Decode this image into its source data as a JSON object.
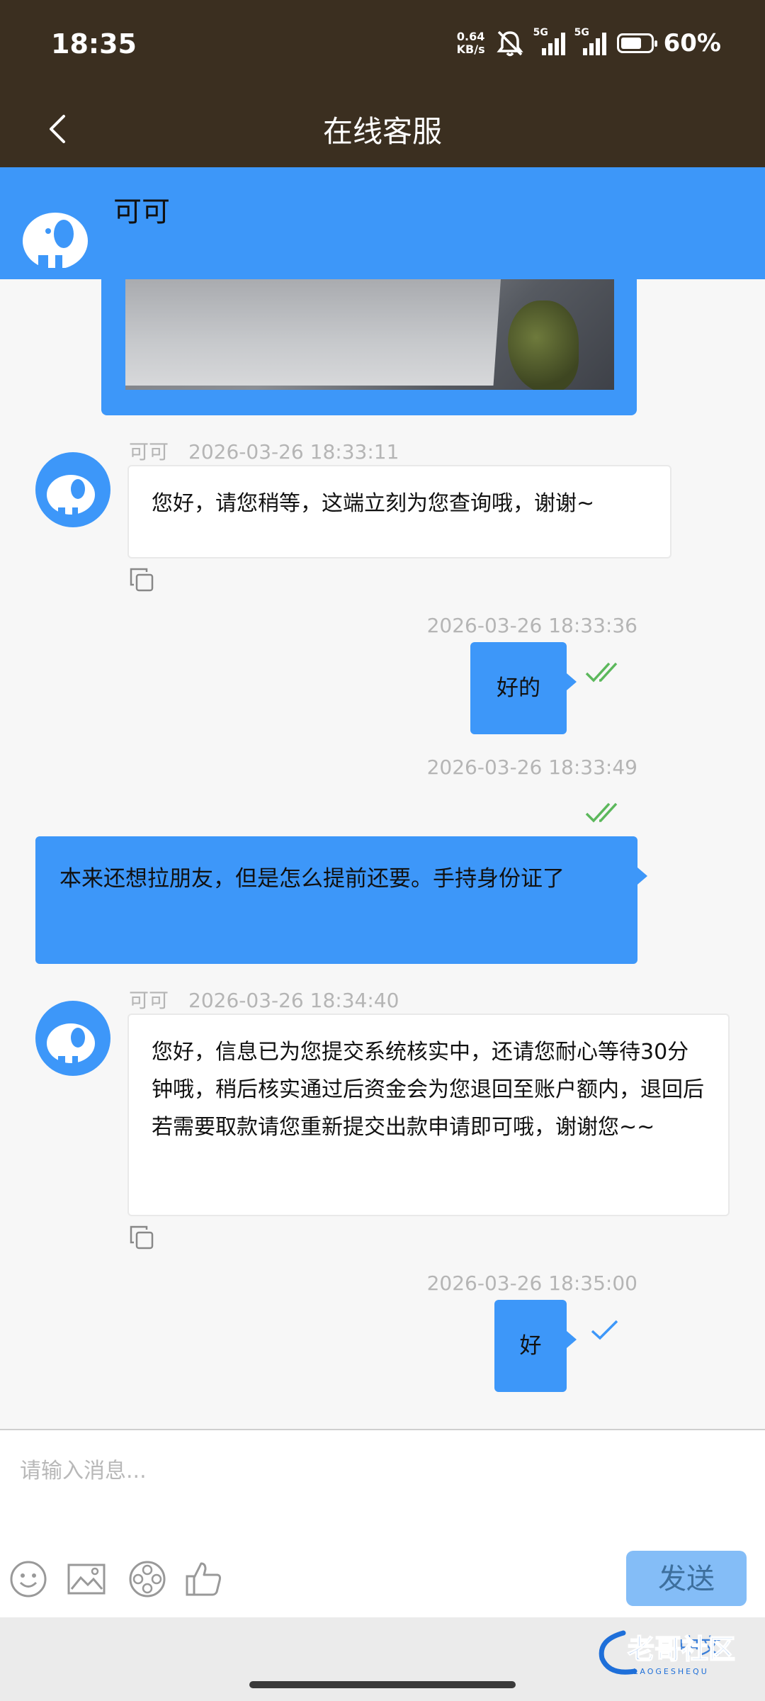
{
  "status_bar": {
    "time": "18:35",
    "net_speed_top": "0.64",
    "net_speed_bottom": "KB/s",
    "signal1": "5G",
    "signal2": "5G",
    "battery": "60%"
  },
  "nav": {
    "title": "在线客服"
  },
  "agent": {
    "name": "可可"
  },
  "messages": [
    {
      "sender": "可可",
      "time": "2026-03-26 18:33:11",
      "text": "您好，请您稍等，这端立刻为您查询哦，谢谢~"
    },
    {
      "time": "2026-03-26 18:33:36",
      "text": "好的"
    },
    {
      "time": "2026-03-26 18:33:49",
      "text": "本来还想拉朋友，但是怎么提前还要。手持身份证了"
    },
    {
      "sender": "可可",
      "time": "2026-03-26 18:34:40",
      "text": "您好，信息已为您提交系统核实中，还请您耐心等待30分钟哦，稍后核实通过后资金会为您退回至账户额内，退回后若需要取款请您重新提交出款申请即可哦，谢谢您~~"
    },
    {
      "time": "2026-03-26 18:35:00",
      "text": "好"
    }
  ],
  "composer": {
    "placeholder": "请输入消息...",
    "send_label": "发送",
    "lang_label": "中文"
  },
  "watermark": {
    "text": "老哥社区",
    "sub": "LAOGESHEQU"
  },
  "colors": {
    "primary": "#3d97f9",
    "header_bg": "#3b2f20",
    "read_check": "#5cb85c",
    "sent_check": "#3d97f9"
  }
}
